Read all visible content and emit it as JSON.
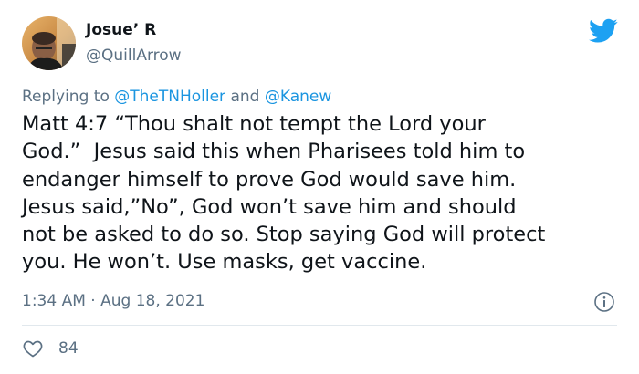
{
  "author": {
    "display_name": "Josue’ R",
    "handle": "@QuillArrow",
    "avatar_icon": "profile-photo"
  },
  "brand": {
    "logo_icon": "twitter-bird-icon",
    "accent_color": "#1da1f2"
  },
  "reply_context": {
    "prefix": "Replying to",
    "mention_1": "@TheTNHoller",
    "conjunction": "and",
    "mention_2": "@Kanew",
    "mention_color": "#1b95e0"
  },
  "tweet": {
    "lines": [
      "Matt 4:7 “Thou shalt not tempt the Lord your",
      "God.”  Jesus said this when Pharisees told him to",
      "endanger himself to prove God would save him.",
      "Jesus said,”No”, God won’t save him and should",
      "not be asked to do so. Stop saying God will protect",
      "you. He won’t. Use masks, get vaccine."
    ]
  },
  "meta": {
    "time": "1:34 AM",
    "separator": "·",
    "date": "Aug 18, 2021",
    "info_icon": "info-icon"
  },
  "engagement": {
    "like_icon": "heart-icon",
    "like_count": "84"
  }
}
